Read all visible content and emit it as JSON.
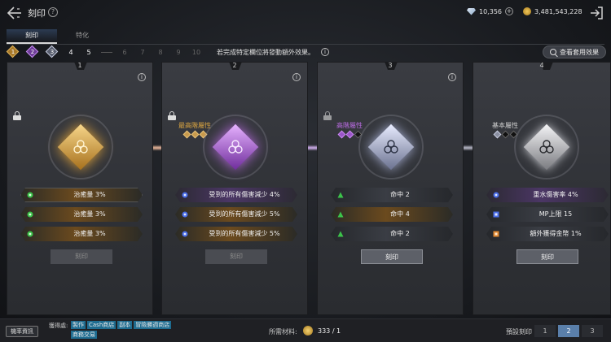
{
  "header": {
    "title": "刻印",
    "currencies": [
      {
        "icon": "gem-icon",
        "value": "10,356"
      },
      {
        "icon": "gold-coin-icon",
        "value": "3,481,543,228"
      }
    ]
  },
  "tabs": [
    {
      "label": "刻印",
      "active": true
    },
    {
      "label": "特化",
      "active": false
    }
  ],
  "slots": {
    "filled": [
      "1",
      "2",
      "3"
    ],
    "numbers": [
      "4",
      "5",
      "6",
      "7",
      "8",
      "9",
      "10"
    ],
    "hint": "若完成特定欄位將發動額外效果。"
  },
  "view_set_label": "查看套用效果",
  "colors": {
    "gold": "#d9a441",
    "purple": "#b86be0",
    "silver": "#c8cde0",
    "white": "#e4e4e8",
    "green_icon": "#3cc24a",
    "blue_icon": "#4b6ee8",
    "orange_icon": "#e0872e"
  },
  "cards": [
    {
      "number": "1",
      "tier_name": "",
      "stats": [
        {
          "icon": "green-circle-icon",
          "text": "治癒量 3%"
        },
        {
          "icon": "green-circle-icon",
          "text": "治癒量 3%"
        },
        {
          "icon": "green-circle-icon",
          "text": "治癒量 3%"
        }
      ],
      "button_label": "刻印",
      "button_enabled": false
    },
    {
      "number": "2",
      "tier_name": "最高階屬性",
      "stats": [
        {
          "icon": "blue-circle-icon",
          "text": "受到的所有傷害減少 4%"
        },
        {
          "icon": "blue-circle-icon",
          "text": "受到的所有傷害減少 5%"
        },
        {
          "icon": "blue-circle-icon",
          "text": "受到的所有傷害減少 5%"
        }
      ],
      "button_label": "刻印",
      "button_enabled": false
    },
    {
      "number": "3",
      "tier_name": "高階屬性",
      "stats": [
        {
          "icon": "green-triangle-icon",
          "text": "命中 2"
        },
        {
          "icon": "green-triangle-icon",
          "text": "命中 4"
        },
        {
          "icon": "green-triangle-icon",
          "text": "命中 2"
        }
      ],
      "button_label": "刻印",
      "button_enabled": true
    },
    {
      "number": "4",
      "tier_name": "基本屬性",
      "stats": [
        {
          "icon": "blue-circle-icon",
          "text": "重水傷害率 4%"
        },
        {
          "icon": "blue-square-icon",
          "text": "MP上限 15"
        },
        {
          "icon": "orange-square-icon",
          "text": "額外獲得金幣 1%"
        }
      ],
      "button_label": "刻印",
      "button_enabled": true
    }
  ],
  "footer": {
    "odds_label": "機率資訊",
    "obtain_label": "獲得處:",
    "obtain_links": [
      "製作",
      "Cash商店",
      "副本",
      "冒險勝週商店",
      "商務交易"
    ],
    "material_label": "所需材料:",
    "material_count": "333 / 1",
    "preset_label": "預設刻印",
    "presets": [
      "1",
      "2",
      "3"
    ],
    "active_preset": "2"
  }
}
